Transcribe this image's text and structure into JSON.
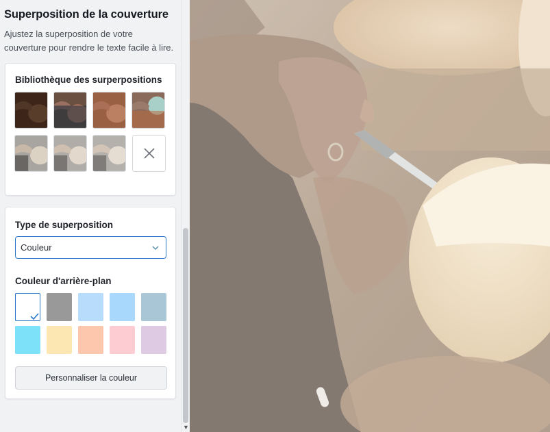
{
  "panel": {
    "title": "Superposition de la couverture",
    "description": "Ajustez la superposition de votre couverture pour rendre le texte facile à lire."
  },
  "library": {
    "heading": "Bibliothèque des surperpositions",
    "thumbnails": [
      {
        "name": "dark-brown",
        "tint": "#3a2418"
      },
      {
        "name": "navy-brown",
        "tint": "#2a3a4a"
      },
      {
        "name": "sepia",
        "tint": "#9a5a3a"
      },
      {
        "name": "teal-warm",
        "tint": "#4a7a8a"
      },
      {
        "name": "light-gray-1",
        "tint": "#9c9a98"
      },
      {
        "name": "light-gray-2",
        "tint": "#a8a6a4"
      },
      {
        "name": "light-gray-3",
        "tint": "#b0aeac"
      }
    ]
  },
  "overlay_type": {
    "heading": "Type de superposition",
    "selected": "Couleur"
  },
  "background_color": {
    "heading": "Couleur d'arrière-plan",
    "swatches": [
      "#ffffff",
      "#999999",
      "#b8dcfb",
      "#a8d8fb",
      "#a9c6d6",
      "#7de1fa",
      "#fce6b1",
      "#fdc7ae",
      "#fdcbd2",
      "#dfcae3"
    ],
    "selected_index": 0,
    "customize_label": "Personnaliser la couleur"
  }
}
